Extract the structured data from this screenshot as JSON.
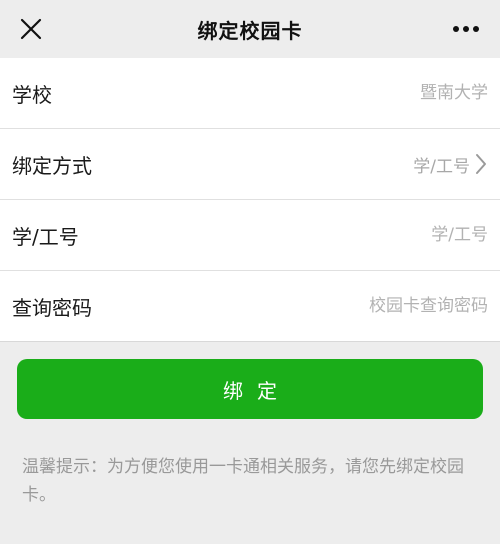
{
  "navbar": {
    "title": "绑定校园卡",
    "close_icon": "close-icon",
    "more_icon": "more-icon"
  },
  "form": {
    "school": {
      "label": "学校",
      "placeholder": "暨南大学"
    },
    "bind_method": {
      "label": "绑定方式",
      "value": "学/工号",
      "icon": "chevron-right-icon"
    },
    "student_id": {
      "label": "学/工号",
      "placeholder": "学/工号"
    },
    "password": {
      "label": "查询密码",
      "placeholder": "校园卡查询密码"
    }
  },
  "bind_button": {
    "label": "绑定"
  },
  "tip": {
    "text": "温馨提示：为方便您使用一卡通相关服务，请您先绑定校园卡。"
  },
  "colors": {
    "background": "#ededed",
    "primary_button": "#1aad19",
    "placeholder": "#b2b2b2",
    "tip_text": "#999999"
  }
}
